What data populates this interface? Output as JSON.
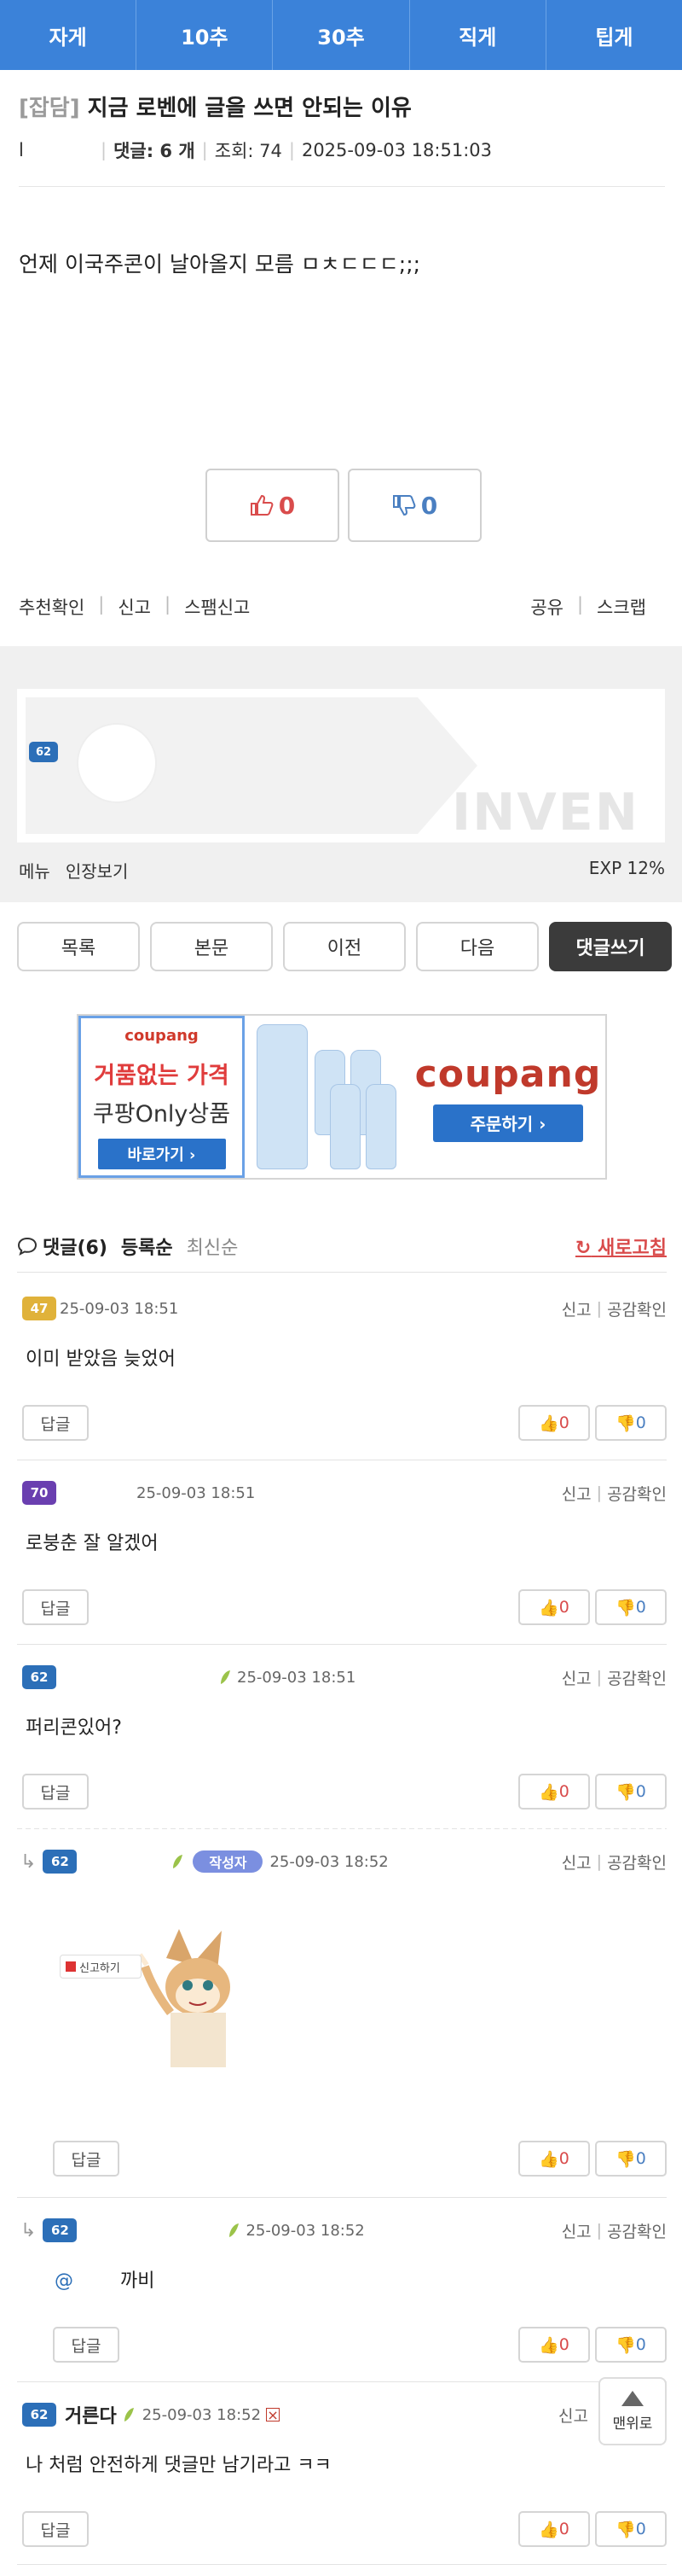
{
  "colors": {
    "nav": "#3b82d9",
    "up": "#d94c4c",
    "down": "#4a7fc1",
    "author_badge": "#7b8fe0"
  },
  "nav": {
    "tabs": [
      "자게",
      "10추",
      "30추",
      "직게",
      "팁게"
    ]
  },
  "post": {
    "category": "[잡담]",
    "title": "지금 로벤에 글을 쓰면 안되는 이유",
    "author": "l",
    "comments_label": "댓글: 6 개",
    "views": "조회: 74",
    "datetime": "2025-09-03 18:51:03",
    "body": "언제 이국주콘이 날아올지 모름 ㅁㅊㄷㄷㄷ;;;",
    "upvotes": "0",
    "downvotes": "0"
  },
  "post_links": {
    "recommend_check": "추천확인",
    "report": "신고",
    "spam_report": "스팸신고",
    "share": "공유",
    "scrap": "스크랩"
  },
  "profile": {
    "level": "62",
    "logo": "INVEN",
    "menu": "메뉴",
    "cert": "인장보기",
    "exp": "EXP 12%"
  },
  "actions": {
    "list": "목록",
    "body": "본문",
    "prev": "이전",
    "next": "다음",
    "write": "댓글쓰기"
  },
  "ad": {
    "brand": "coupang",
    "headline1": "거품없는 가격",
    "headline2": "쿠팡Only상품",
    "go": "바로가기 ›",
    "order": "주문하기 ›"
  },
  "comments_header": {
    "title": "댓글(6)",
    "sort_reg": "등록순",
    "sort_new": "최신순",
    "refresh": "새로고침"
  },
  "comment_common": {
    "report": "신고",
    "empathy": "공감확인",
    "reply": "답글"
  },
  "comments": [
    {
      "level": "47",
      "level_color": "#e0b23a",
      "nick": "",
      "date": "25-09-03 18:51",
      "text": "이미 받았음 늦었어",
      "up": "0",
      "down": "0"
    },
    {
      "level": "70",
      "level_color": "#6a3fb0",
      "nick": "",
      "date": "25-09-03 18:51",
      "text": "로붕춘   잘 알겠어",
      "up": "0",
      "down": "0"
    },
    {
      "level": "62",
      "level_color": "#2c6fb8",
      "nick": "",
      "date": "25-09-03 18:51",
      "text": "퍼리콘있어?",
      "up": "0",
      "down": "0"
    },
    {
      "level": "62",
      "level_color": "#2c6fb8",
      "nick": "",
      "author_badge": "작성자",
      "date": "25-09-03 18:52",
      "report_tag": "신고하기",
      "up": "0",
      "down": "0"
    },
    {
      "level": "62",
      "level_color": "#2c6fb8",
      "nick": "",
      "date": "25-09-03 18:52",
      "mention": "@",
      "text": "까비",
      "up": "0",
      "down": "0"
    },
    {
      "level": "62",
      "level_color": "#2c6fb8",
      "nick": "거른다",
      "date": "25-09-03 18:52",
      "text": "나 처럼 안전하게 댓글만 남기라고 ㅋㅋ",
      "up": "0",
      "down": "0"
    }
  ],
  "top_button": "맨위로"
}
